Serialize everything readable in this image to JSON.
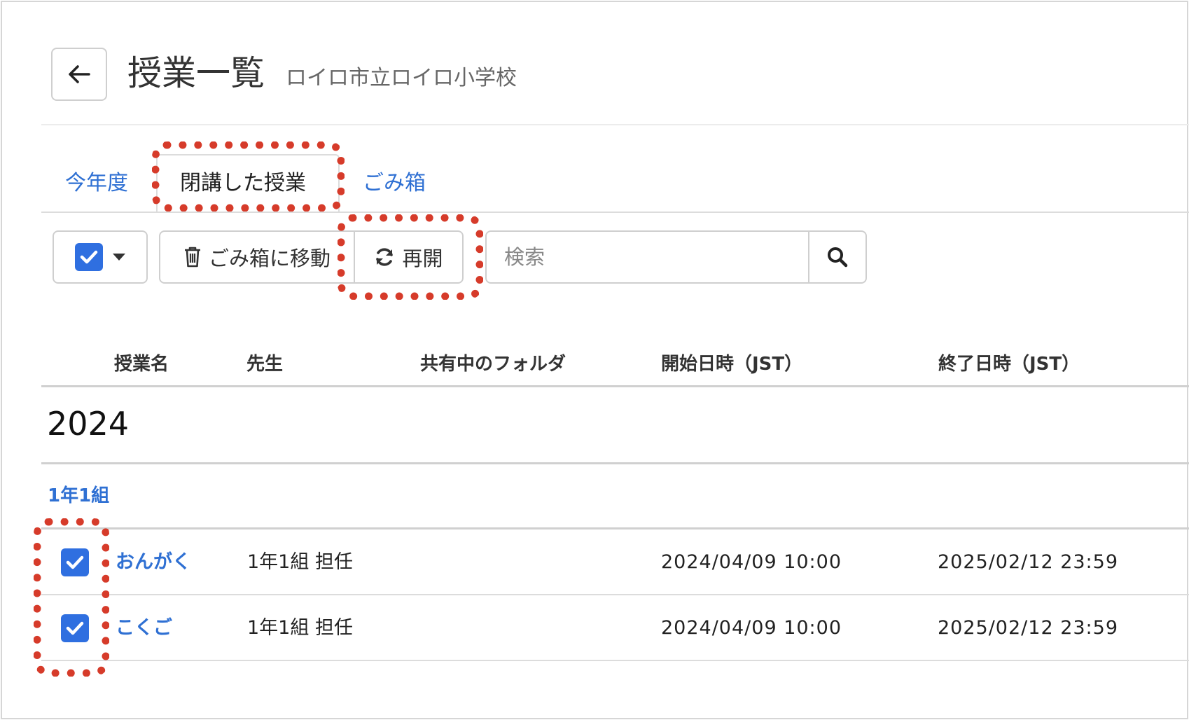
{
  "header": {
    "back_label": "←",
    "title": "授業一覧",
    "subtitle": "ロイロ市立ロイロ小学校"
  },
  "tabs": [
    {
      "label": "今年度",
      "active": false
    },
    {
      "label": "閉講した授業",
      "active": true
    },
    {
      "label": "ごみ箱",
      "active": false
    }
  ],
  "toolbar": {
    "move_to_trash_label": "ごみ箱に移動",
    "reopen_label": "再開",
    "search_placeholder": "検索"
  },
  "table": {
    "columns": [
      "授業名",
      "先生",
      "共有中のフォルダ",
      "開始日時（JST）",
      "終了日時（JST）"
    ],
    "year": "2024",
    "group": "1年1組",
    "rows": [
      {
        "name": "おんがく",
        "teacher": "1年1組 担任",
        "folder": "",
        "start": "2024/04/09 10:00",
        "end": "2025/02/12 23:59",
        "checked": true
      },
      {
        "name": "こくご",
        "teacher": "1年1組 担任",
        "folder": "",
        "start": "2024/04/09 10:00",
        "end": "2025/02/12 23:59",
        "checked": true
      }
    ]
  },
  "colors": {
    "accent": "#2f70d3",
    "checkbox": "#2f6fe0",
    "highlight": "#d63b2a"
  }
}
